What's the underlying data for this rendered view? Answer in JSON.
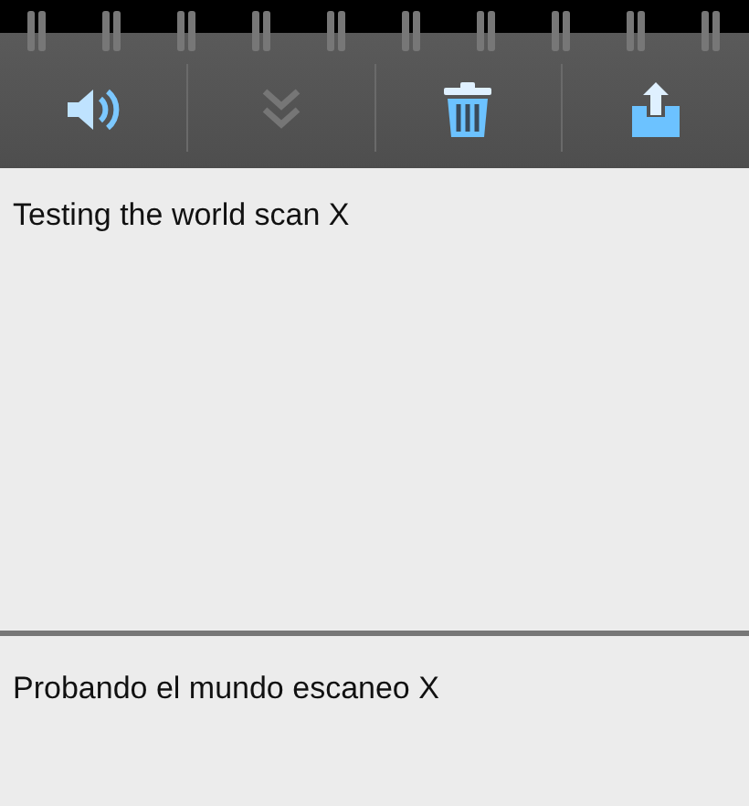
{
  "toolbar": {
    "buttons": [
      {
        "kind": "speaker",
        "disabled": false
      },
      {
        "kind": "chevrons",
        "disabled": true
      },
      {
        "kind": "trash",
        "disabled": false
      },
      {
        "kind": "share",
        "disabled": false
      }
    ]
  },
  "panels": [
    {
      "text": "Testing the world scan X"
    },
    {
      "text": "Probando el mundo escaneo X"
    }
  ]
}
